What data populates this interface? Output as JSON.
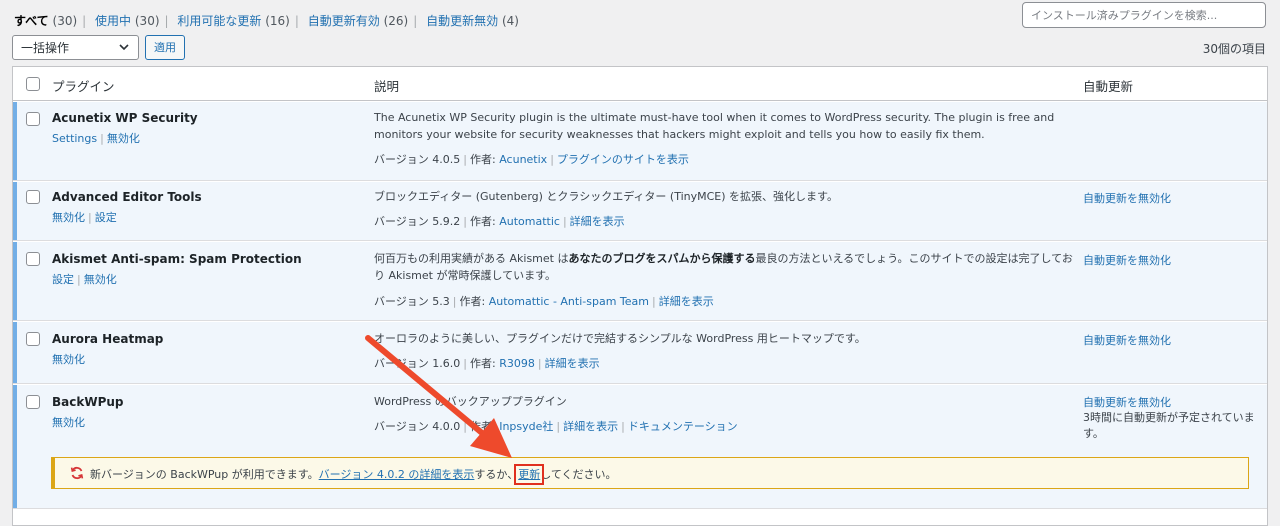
{
  "filters": {
    "all": "すべて",
    "all_count": "(30)",
    "active": "使用中",
    "active_count": "(30)",
    "updates": "利用可能な更新",
    "updates_count": "(16)",
    "auto_on": "自動更新有効",
    "auto_on_count": "(26)",
    "auto_off": "自動更新無効",
    "auto_off_count": "(4)"
  },
  "search": {
    "placeholder": "インストール済みプラグインを検索..."
  },
  "bulk": {
    "selected": "一括操作",
    "apply": "適用"
  },
  "item_count": "30個の項目",
  "columns": {
    "plugin": "プラグイン",
    "description": "説明",
    "auto_update": "自動更新"
  },
  "labels": {
    "version": "バージョン",
    "author": "作者:"
  },
  "plugins": [
    {
      "name": "Acunetix WP Security",
      "actions": [
        "Settings",
        "無効化"
      ],
      "description": "The Acunetix WP Security plugin is the ultimate must-have tool when it comes to WordPress security. The plugin is free and monitors your website for security weaknesses that hackers might exploit and tells you how to easily fix them.",
      "version": "4.0.5",
      "author": "Acunetix",
      "link": "プラグインのサイトを表示",
      "auto": ""
    },
    {
      "name": "Advanced Editor Tools",
      "actions": [
        "無効化",
        "設定"
      ],
      "description": "ブロックエディター (Gutenberg) とクラシックエディター (TinyMCE) を拡張、強化します。",
      "version": "5.9.2",
      "author": "Automattic",
      "link": "詳細を表示",
      "auto": "自動更新を無効化"
    },
    {
      "name": "Akismet Anti-spam: Spam Protection",
      "actions": [
        "設定",
        "無効化"
      ],
      "description_pre": "何百万もの利用実績がある Akismet は",
      "description_bold": "あなたのブログをスパムから保護する",
      "description_post": "最良の方法といえるでしょう。このサイトでの設定は完了しており Akismet が常時保護しています。",
      "version": "5.3",
      "author": "Automattic - Anti-spam Team",
      "link": "詳細を表示",
      "auto": "自動更新を無効化"
    },
    {
      "name": "Aurora Heatmap",
      "actions": [
        "無効化"
      ],
      "description": "オーロラのように美しい、プラグインだけで完結するシンプルな WordPress 用ヒートマップです。",
      "version": "1.6.0",
      "author": "R3098",
      "link": "詳細を表示",
      "auto": "自動更新を無効化"
    },
    {
      "name": "BackWPup",
      "actions": [
        "無効化"
      ],
      "description": "WordPress のバックアッププラグイン",
      "version": "4.0.0",
      "author": "Inpsyde社",
      "link": "詳細を表示",
      "link2": "ドキュメンテーション",
      "auto": "自動更新を無効化",
      "schedule": "3時間に自動更新が予定されています。"
    }
  ],
  "notice": {
    "pre": "新バージョンの BackWPup が利用できます。",
    "details_link": "バージョン 4.0.2 の詳細を表示",
    "mid": "するか、",
    "update_link": "更新",
    "post": "してください。"
  },
  "colors": {
    "accent": "#2271b1",
    "highlight": "#e0301e",
    "active_bar": "#72aee6",
    "notice_border": "#dba617"
  }
}
